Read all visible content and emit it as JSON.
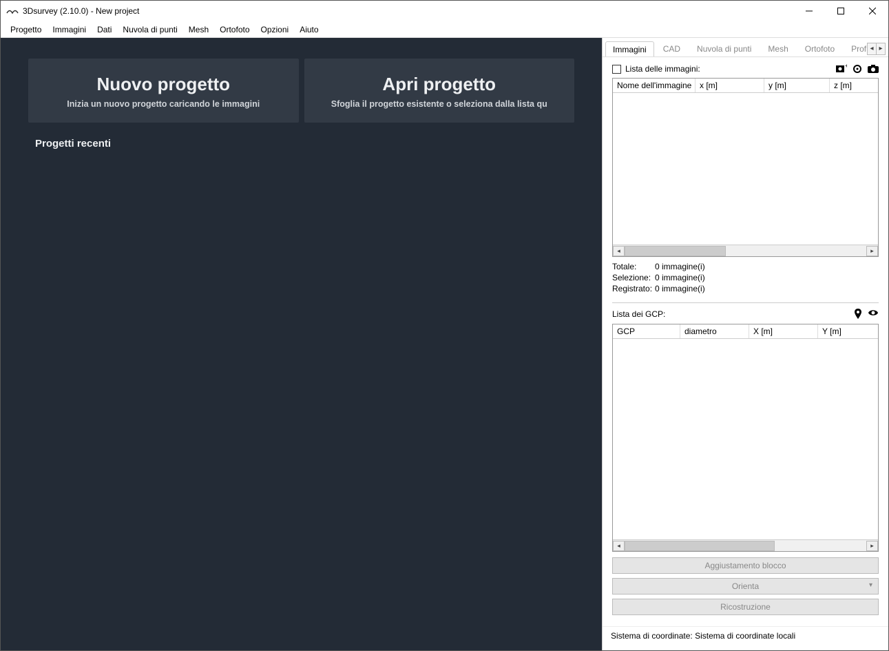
{
  "window": {
    "title": "3Dsurvey (2.10.0) - New project"
  },
  "menu": {
    "items": [
      "Progetto",
      "Immagini",
      "Dati",
      "Nuvola di punti",
      "Mesh",
      "Ortofoto",
      "Opzioni",
      "Aiuto"
    ]
  },
  "main": {
    "new_project": {
      "title": "Nuovo progetto",
      "subtitle": "Inizia un nuovo progetto caricando le immagini"
    },
    "open_project": {
      "title": "Apri progetto",
      "subtitle": "Sfoglia il progetto esistente o seleziona dalla lista qu"
    },
    "recent_title": "Progetti recenti"
  },
  "side": {
    "tabs": [
      "Immagini",
      "CAD",
      "Nuvola di punti",
      "Mesh",
      "Ortofoto",
      "Profilo"
    ],
    "active_tab": 0,
    "image_list_label": "Lista delle immagini:",
    "image_table": {
      "columns": [
        "Nome dell'immagine",
        "x [m]",
        "y [m]",
        "z [m]"
      ]
    },
    "stats": {
      "total_label": "Totale:",
      "total_value": "0 immagine(i)",
      "selection_label": "Selezione:",
      "selection_value": "0 immagine(i)",
      "registered_label": "Registrato:",
      "registered_value": "0 immagine(i)"
    },
    "gcp_label": "Lista dei GCP:",
    "gcp_table": {
      "columns": [
        "GCP",
        "diametro",
        "X [m]",
        "Y [m]"
      ]
    },
    "buttons": {
      "adjust": "Aggiustamento blocco",
      "orient": "Orienta",
      "reconstruct": "Ricostruzione"
    },
    "status": "Sistema di coordinate: Sistema di coordinate locali"
  }
}
